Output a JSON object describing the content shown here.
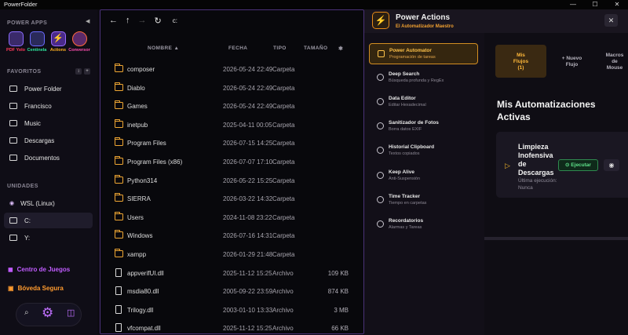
{
  "window": {
    "title": "PowerFolder",
    "controls": [
      "—",
      "☐",
      "✕"
    ]
  },
  "sidebar": {
    "power_apps_label": "POWER APPS",
    "apps": [
      {
        "label": "PDF Yolo",
        "color": "#ff3b5c",
        "icon": "pdf-yolo-icon"
      },
      {
        "label": "Centinela",
        "color": "#2ee59d",
        "icon": "centinela-icon"
      },
      {
        "label": "Actions",
        "color": "#ffb020",
        "icon": "lightning-icon"
      },
      {
        "label": "Conversor",
        "color": "#ff4fb0",
        "icon": "converter-icon"
      }
    ],
    "favorites_label": "FAVORITOS",
    "favorites": [
      {
        "label": "Power Folder"
      },
      {
        "label": "Francisco"
      },
      {
        "label": "Music"
      },
      {
        "label": "Descargas"
      },
      {
        "label": "Documentos"
      }
    ],
    "units_label": "UNIDADES",
    "units": [
      {
        "label": "WSL (Linux)"
      },
      {
        "label": "C:"
      },
      {
        "label": "Y:"
      }
    ],
    "special": [
      {
        "label": "Centro de Juegos",
        "color": "#c05cff"
      },
      {
        "label": "Bóveda Segura",
        "color": "#ff9b2f"
      }
    ]
  },
  "browser": {
    "path": "c:",
    "columns": {
      "name": "NOMBRE ▲",
      "date": "FECHA",
      "type": "TIPO",
      "size": "TAMAÑO"
    },
    "rows": [
      {
        "name": "composer",
        "date": "2026-05-24 22:49",
        "type": "Carpeta",
        "size": "",
        "kind": "folder"
      },
      {
        "name": "Diablo",
        "date": "2026-05-24 22:49",
        "type": "Carpeta",
        "size": "",
        "kind": "folder"
      },
      {
        "name": "Games",
        "date": "2026-05-24 22:49",
        "type": "Carpeta",
        "size": "",
        "kind": "folder"
      },
      {
        "name": "inetpub",
        "date": "2025-04-11 00:05",
        "type": "Carpeta",
        "size": "",
        "kind": "folder"
      },
      {
        "name": "Program Files",
        "date": "2026-07-15 14:25",
        "type": "Carpeta",
        "size": "",
        "kind": "folder"
      },
      {
        "name": "Program Files (x86)",
        "date": "2026-07-07 17:10",
        "type": "Carpeta",
        "size": "",
        "kind": "folder"
      },
      {
        "name": "Python314",
        "date": "2026-05-22 15:25",
        "type": "Carpeta",
        "size": "",
        "kind": "folder"
      },
      {
        "name": "SIERRA",
        "date": "2026-03-22 14:32",
        "type": "Carpeta",
        "size": "",
        "kind": "folder"
      },
      {
        "name": "Users",
        "date": "2024-11-08 23:22",
        "type": "Carpeta",
        "size": "",
        "kind": "folder"
      },
      {
        "name": "Windows",
        "date": "2026-07-16 14:31",
        "type": "Carpeta",
        "size": "",
        "kind": "folder"
      },
      {
        "name": "xampp",
        "date": "2026-01-29 21:48",
        "type": "Carpeta",
        "size": "",
        "kind": "folder"
      },
      {
        "name": "appverifUI.dll",
        "date": "2025-11-12 15:25",
        "type": "Archivo",
        "size": "109 KB",
        "kind": "file"
      },
      {
        "name": "msdia80.dll",
        "date": "2005-09-22 23:59",
        "type": "Archivo",
        "size": "874 KB",
        "kind": "file"
      },
      {
        "name": "Trilogy.dll",
        "date": "2003-01-10 13:33",
        "type": "Archivo",
        "size": "3 MB",
        "kind": "file"
      },
      {
        "name": "vfcompat.dll",
        "date": "2025-11-12 15:25",
        "type": "Archivo",
        "size": "66 KB",
        "kind": "file"
      }
    ]
  },
  "panel": {
    "title": "Power Actions",
    "subtitle": "El Automatizador Maestro",
    "close": "✕",
    "menu": [
      {
        "title": "Power Automator",
        "sub": "Programación de tareas"
      },
      {
        "title": "Deep Search",
        "sub": "Búsqueda profunda y RegEx"
      },
      {
        "title": "Data Editor",
        "sub": "Editar Hexadecimal"
      },
      {
        "title": "Sanitizador de Fotos",
        "sub": "Borra datos EXIF"
      },
      {
        "title": "Historial Clipboard",
        "sub": "Textos copiados"
      },
      {
        "title": "Keep Alive",
        "sub": "Anti-Suspensión"
      },
      {
        "title": "Time Tracker",
        "sub": "Tiempo en carpetas"
      },
      {
        "title": "Recordatorios",
        "sub": "Alarmas y Tareas"
      }
    ],
    "tabs": [
      {
        "l1": "Mis",
        "l2": "Flujos",
        "l3": "(1)"
      },
      {
        "l1": "+ Nuevo",
        "l2": "Flujo",
        "l3": ""
      },
      {
        "l1": "Macros",
        "l2": "de",
        "l3": "Mouse"
      }
    ],
    "heading_line1": "Mis Automatizaciones",
    "heading_line2": "Activas",
    "flow": {
      "title_lines": [
        "Limpieza",
        "Inofensiva",
        "de",
        "Descargas"
      ],
      "run_label": "⊙ Ejecutar",
      "last_run_label": "Última ejecución:",
      "last_run_value": "Nunca"
    }
  }
}
